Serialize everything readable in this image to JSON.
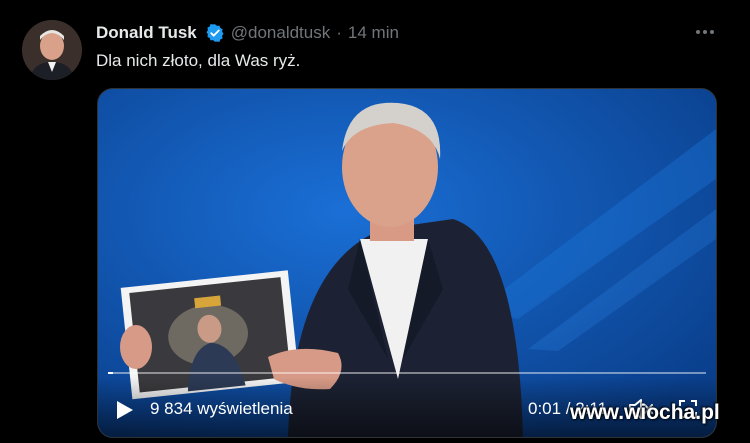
{
  "tweet": {
    "author_name": "Donald Tusk",
    "handle": "@donaldtusk",
    "separator": "·",
    "time": "14 min",
    "text": "Dla nich złoto, dla Was ryż.",
    "more_icon": "more-dots-icon",
    "verified_icon": "verified-badge-icon"
  },
  "video": {
    "views": "9 834 wyświetlenia",
    "time": "0:01 / 2:11",
    "progress": 0.008,
    "play_icon": "play-icon",
    "mute_icon": "speaker-muted-icon",
    "fullscreen_icon": "fullscreen-icon"
  },
  "watermark": "www.wiocha.pl",
  "colors": {
    "background": "#000000",
    "text_primary": "#e7e9ea",
    "text_secondary": "#71767b",
    "verified": "#1d9bf0",
    "video_bg": "#0d4ea8"
  }
}
